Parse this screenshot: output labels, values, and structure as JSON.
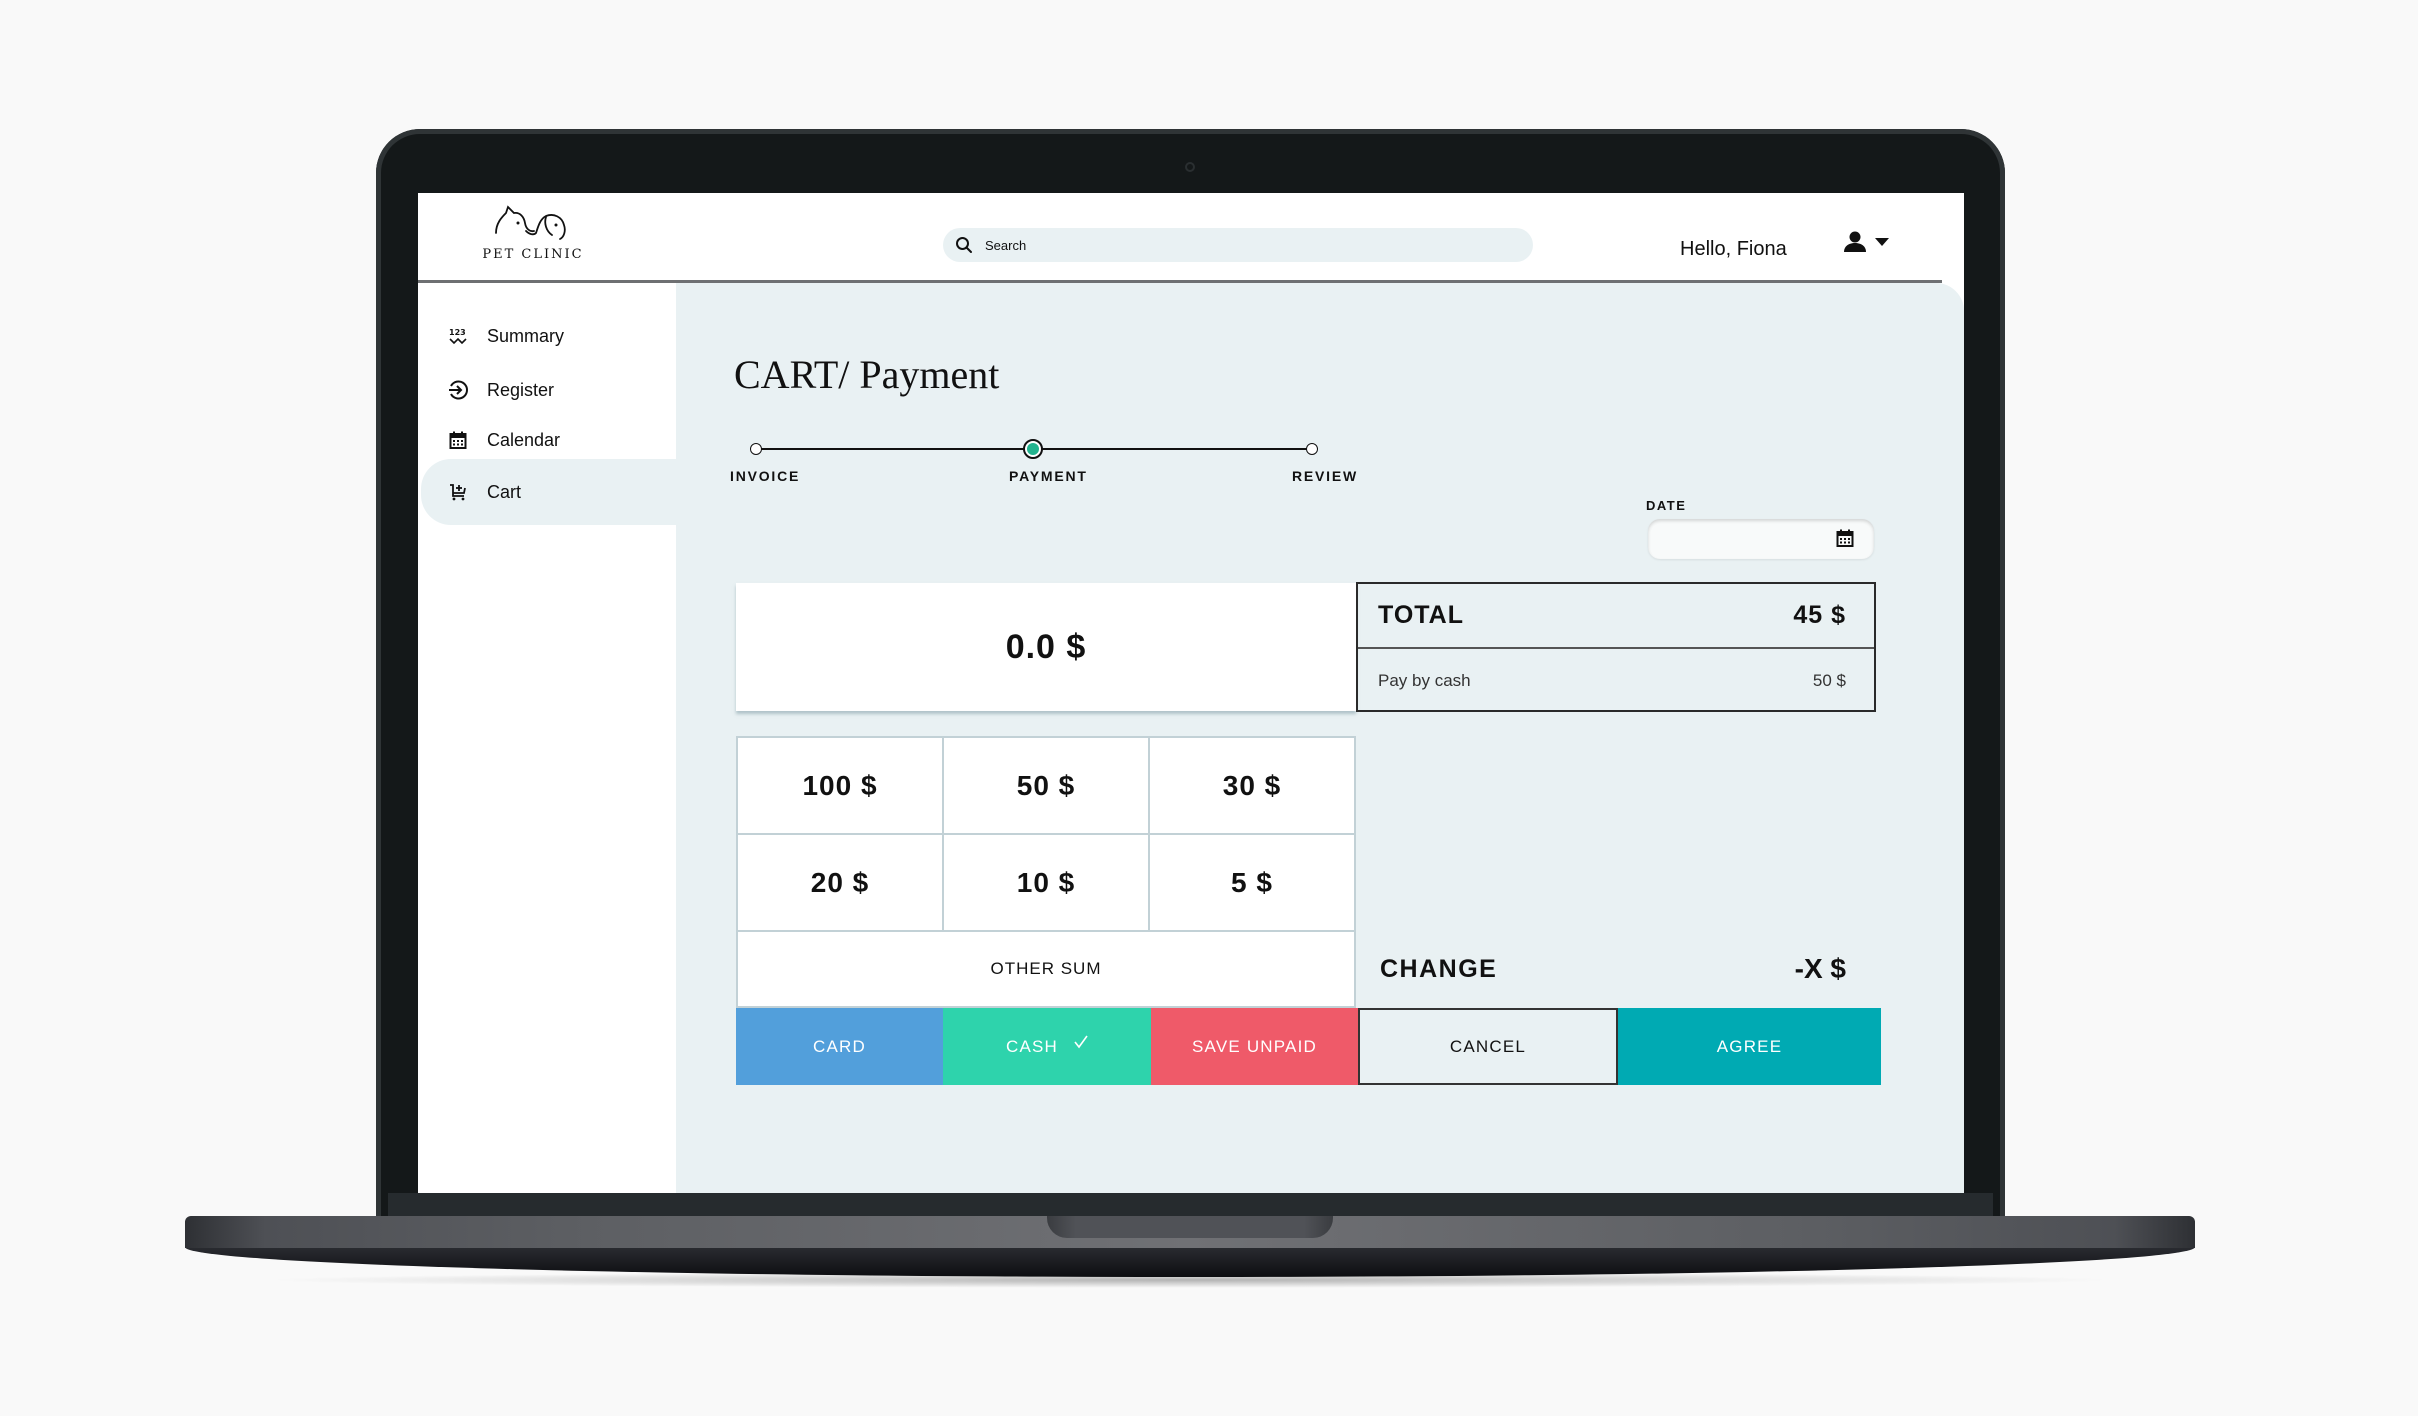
{
  "app": {
    "logo_text": "PET CLINIC"
  },
  "header": {
    "search_placeholder": "Search",
    "search_value": "",
    "greeting": "Hello, Fiona"
  },
  "sidebar": {
    "items": [
      {
        "label": "Summary",
        "icon": "summary-icon",
        "active": false
      },
      {
        "label": "Register",
        "icon": "register-icon",
        "active": false
      },
      {
        "label": "Calendar",
        "icon": "calendar-icon",
        "active": false
      },
      {
        "label": "Cart",
        "icon": "cart-icon",
        "active": true
      }
    ]
  },
  "page": {
    "title": "CART/ Payment",
    "steps": [
      {
        "label": "INVOICE",
        "state": "done"
      },
      {
        "label": "PAYMENT",
        "state": "current"
      },
      {
        "label": "REVIEW",
        "state": "todo"
      }
    ],
    "date_label": "DATE",
    "date_value": "",
    "amount_display": "0.0 $",
    "total_label": "TOTAL",
    "total_value": "45 $",
    "pay_method_label": "Pay by cash",
    "pay_method_value": "50 $",
    "quick_amounts": [
      "100 $",
      "50 $",
      "30 $",
      "20 $",
      "10 $",
      "5 $"
    ],
    "other_sum_label": "OTHER SUM",
    "change_label": "CHANGE",
    "change_value": "-X $",
    "buttons": {
      "card": "CARD",
      "cash": "CASH",
      "save_unpaid": "SAVE UNPAID",
      "cancel": "CANCEL",
      "agree": "AGREE"
    },
    "selected_method": "cash"
  },
  "colors": {
    "card": "#529fdb",
    "cash": "#2ed3ac",
    "save_unpaid": "#ef5a69",
    "agree": "#00aab3",
    "step_active": "#22b38e",
    "panel_bg": "#e9f1f3"
  }
}
